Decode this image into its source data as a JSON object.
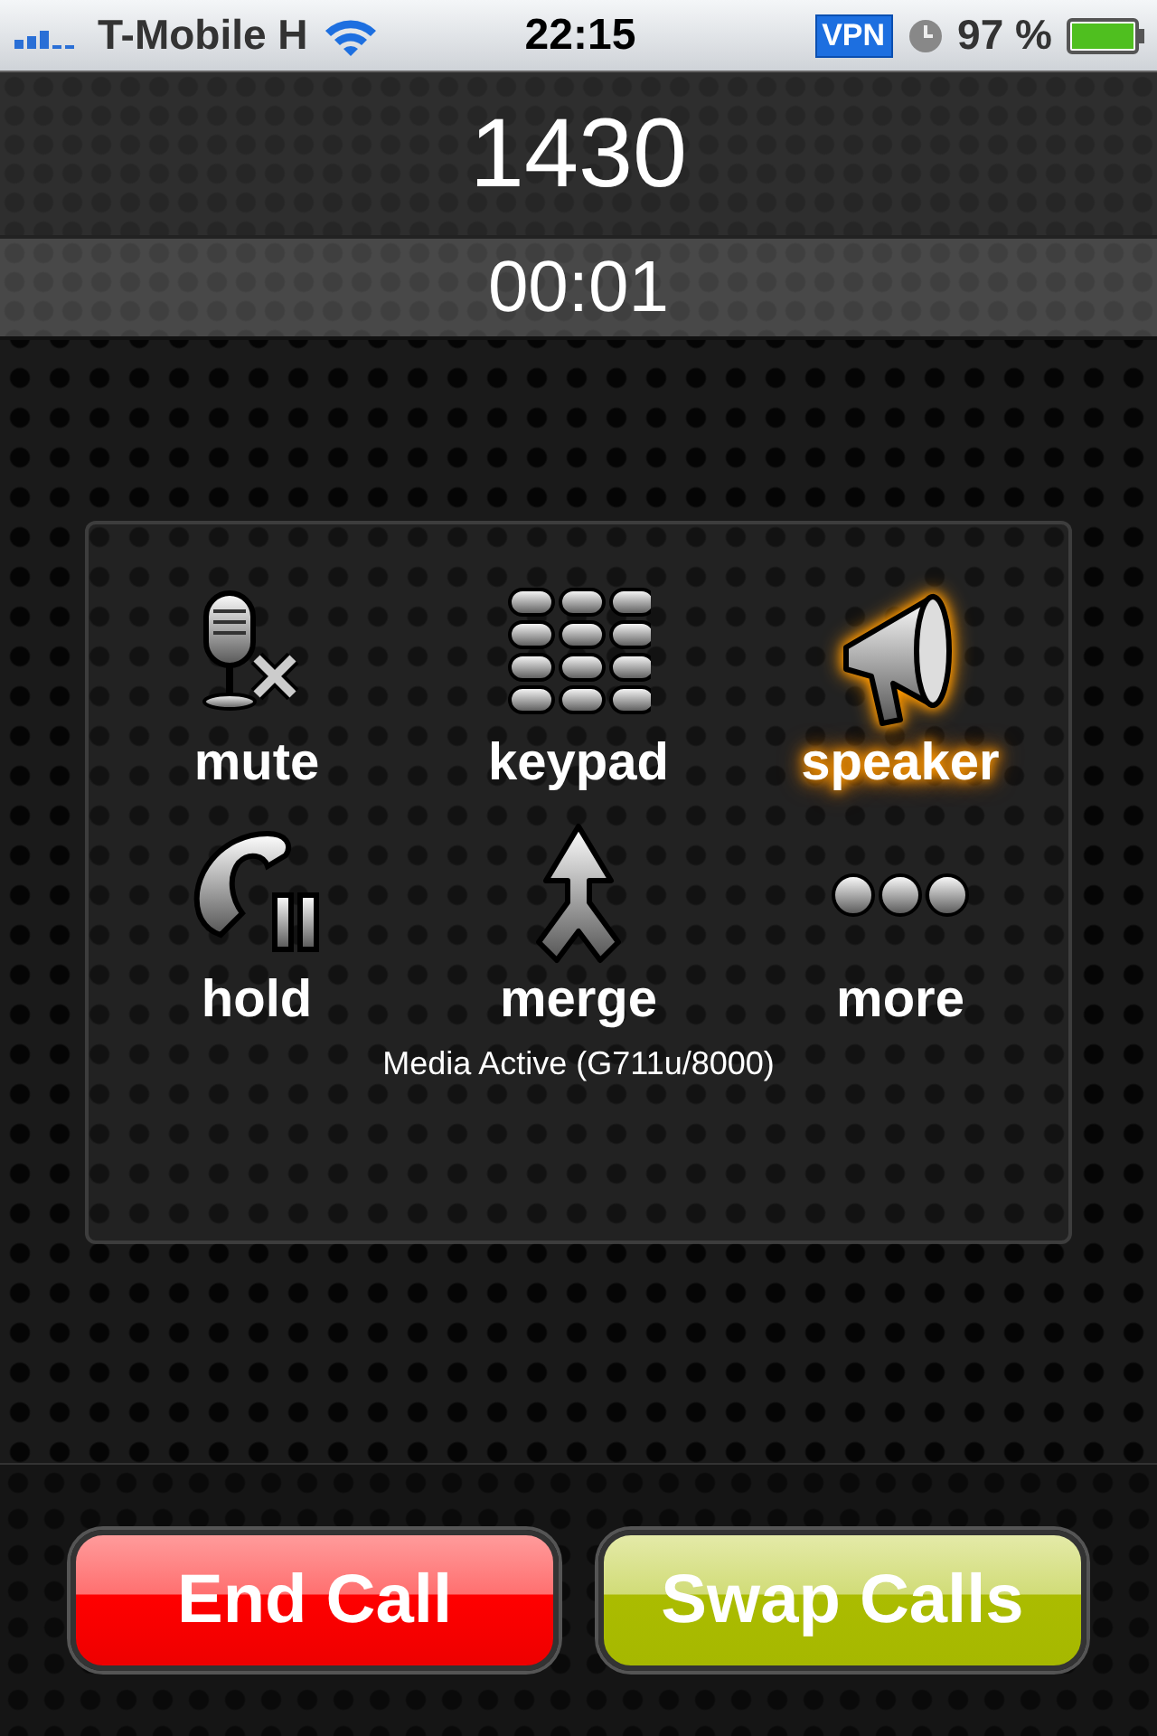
{
  "status_bar": {
    "carrier": "T-Mobile H",
    "time": "22:15",
    "vpn": "VPN",
    "battery": "97 %"
  },
  "call": {
    "number": "1430",
    "duration": "00:01"
  },
  "controls": [
    {
      "kind": "mute",
      "label": "mute",
      "selected": false
    },
    {
      "kind": "keypad",
      "label": "keypad",
      "selected": false
    },
    {
      "kind": "speaker",
      "label": "speaker",
      "selected": true
    },
    {
      "kind": "hold",
      "label": "hold",
      "selected": false
    },
    {
      "kind": "merge",
      "label": "merge",
      "selected": false
    },
    {
      "kind": "more",
      "label": "more",
      "selected": false
    }
  ],
  "media_status": "Media Active (G711u/8000)",
  "buttons": [
    {
      "kind": "end",
      "label": "End Call"
    },
    {
      "kind": "swap",
      "label": "Swap Calls"
    }
  ]
}
